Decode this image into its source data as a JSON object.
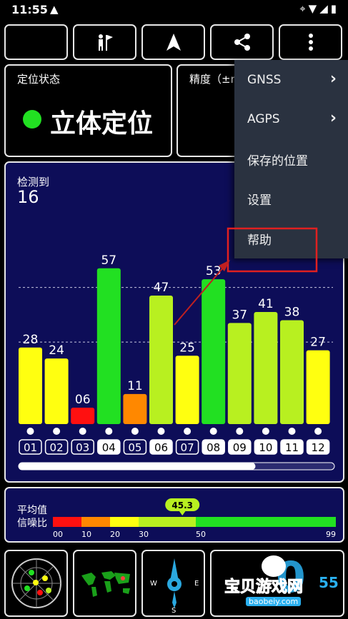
{
  "statusbar": {
    "time": "11:55",
    "warning_icon": "warning-icon",
    "system_icons": "location wifi signal battery"
  },
  "toolbar": {
    "buttons": [
      "night-mode-icon",
      "map-flag-icon",
      "navigation-arrow-icon",
      "share-icon",
      "more-vert-icon"
    ]
  },
  "fix_card": {
    "title": "定位状态",
    "status": "立体定位",
    "status_color": "#22e022"
  },
  "accuracy_card": {
    "title": "精度（±m"
  },
  "satellites": {
    "label": "检测到",
    "count": "16",
    "chart_data": {
      "type": "bar",
      "categories": [
        "01",
        "02",
        "03",
        "04",
        "05",
        "06",
        "07",
        "08",
        "09",
        "10",
        "11",
        "12"
      ],
      "values": [
        28,
        24,
        6,
        57,
        11,
        47,
        25,
        53,
        37,
        41,
        38,
        27
      ],
      "value_labels": [
        "28",
        "24",
        "06",
        "57",
        "11",
        "47",
        "25",
        "53",
        "37",
        "41",
        "38",
        "27"
      ],
      "highlighted": [
        false,
        false,
        false,
        true,
        false,
        true,
        false,
        true,
        true,
        true,
        true,
        true
      ],
      "ylim": [
        0,
        70
      ],
      "gridlines": [
        30,
        50
      ],
      "colors": {
        "red": "#ff1010",
        "orange": "#ff8800",
        "yellow": "#ffff10",
        "yellowgreen": "#b8f020",
        "green": "#22e022"
      }
    },
    "scroll_fraction": 0.75
  },
  "snr": {
    "label_line1": "平均值",
    "label_line2": "信噪比",
    "average": "45.3",
    "average_value": 45.3,
    "tick_labels": [
      "00",
      "10",
      "20",
      "30",
      "50",
      "99"
    ],
    "segments": [
      {
        "from": 0,
        "to": 10,
        "color": "#ff1010"
      },
      {
        "from": 10,
        "to": 20,
        "color": "#ff8800"
      },
      {
        "from": 20,
        "to": 30,
        "color": "#ffff10"
      },
      {
        "from": 30,
        "to": 50,
        "color": "#b8f020"
      },
      {
        "from": 50,
        "to": 99,
        "color": "#22e022"
      }
    ]
  },
  "bottom_tiles": {
    "radar_icon": "sky-radar-icon",
    "map_icon": "world-map-icon",
    "compass_icon": "compass-icon",
    "compass_w": "W",
    "compass_e": "E",
    "compass_s": "S"
  },
  "menu": {
    "items": [
      {
        "label": "GNSS",
        "chevron": "›"
      },
      {
        "label": "AGPS",
        "chevron": "›"
      },
      {
        "label": "保存的位置",
        "chevron": ""
      },
      {
        "label": "设置",
        "chevron": ""
      },
      {
        "label": "帮助",
        "chevron": ""
      }
    ],
    "highlight_color": "#e02020"
  },
  "watermark": {
    "line1": "宝贝游戏网",
    "line2": "baobeiy.com",
    "number": "55"
  }
}
